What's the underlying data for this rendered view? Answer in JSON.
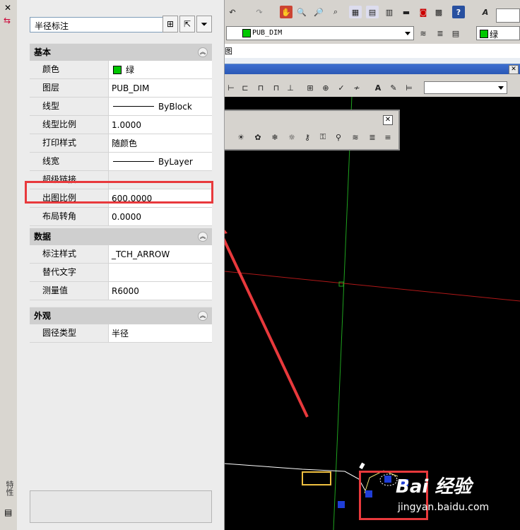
{
  "palette": {
    "object_type": "半径标注",
    "side_title": "特性",
    "sections": [
      {
        "title": "基本",
        "rows": [
          {
            "name": "颜色",
            "value": "绿",
            "swatch": "#00c800"
          },
          {
            "name": "图层",
            "value": "PUB_DIM"
          },
          {
            "name": "线型",
            "value": "ByBlock",
            "line_sample": true
          },
          {
            "name": "线型比例",
            "value": "1.0000"
          },
          {
            "name": "打印样式",
            "value": "随颜色"
          },
          {
            "name": "线宽",
            "value": "ByLayer",
            "line_sample": true
          },
          {
            "name": "超级链接",
            "value": ""
          },
          {
            "name": "出图比例",
            "value": "600.0000"
          },
          {
            "name": "布局转角",
            "value": "0.0000"
          }
        ]
      },
      {
        "title": "数据",
        "rows": [
          {
            "name": "标注样式",
            "value": "_TCH_ARROW"
          },
          {
            "name": "替代文字",
            "value": ""
          },
          {
            "name": "测量值",
            "value": "R6000"
          }
        ]
      },
      {
        "title": "外观",
        "rows": [
          {
            "name": "圆径类型",
            "value": "半径"
          }
        ]
      }
    ]
  },
  "toolbar": {
    "layer_name": "PUB_DIM",
    "color_name": "绿",
    "tab_label": "图"
  },
  "watermark": {
    "brand": "Bai 经验",
    "site": "jingyan.baidu.com"
  },
  "colors": {
    "highlight": "#e8393c",
    "arrow": "#e8393c",
    "axis_green": "#1fa31f",
    "axis_red": "#b01818",
    "selection_grip": "#1f3dd6"
  }
}
